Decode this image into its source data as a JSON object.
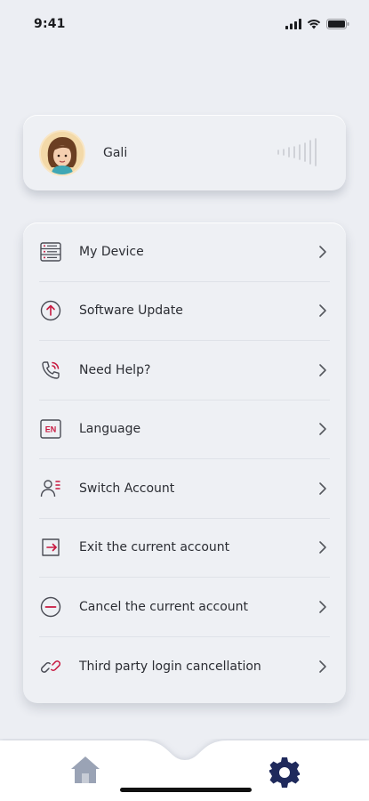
{
  "status_bar": {
    "time": "9:41"
  },
  "profile": {
    "name": "Gali"
  },
  "menu": {
    "items": [
      {
        "label": "My Device",
        "icon": "device-list-icon"
      },
      {
        "label": "Software Update",
        "icon": "upload-arrow-icon"
      },
      {
        "label": "Need Help?",
        "icon": "phone-call-icon"
      },
      {
        "label": "Language",
        "icon": "language-en-icon",
        "badge": "EN"
      },
      {
        "label": "Switch Account",
        "icon": "switch-account-icon"
      },
      {
        "label": "Exit the current account",
        "icon": "exit-icon"
      },
      {
        "label": "Cancel the current account",
        "icon": "minus-circle-icon"
      },
      {
        "label": "Third party login cancellation",
        "icon": "link-icon"
      }
    ]
  },
  "tab_bar": {
    "tabs": [
      {
        "name": "home",
        "icon": "home-icon"
      },
      {
        "name": "settings",
        "icon": "gear-icon"
      }
    ]
  },
  "colors": {
    "accent": "#c8183f",
    "navy": "#1f2a5c",
    "background": "#eceef3"
  }
}
